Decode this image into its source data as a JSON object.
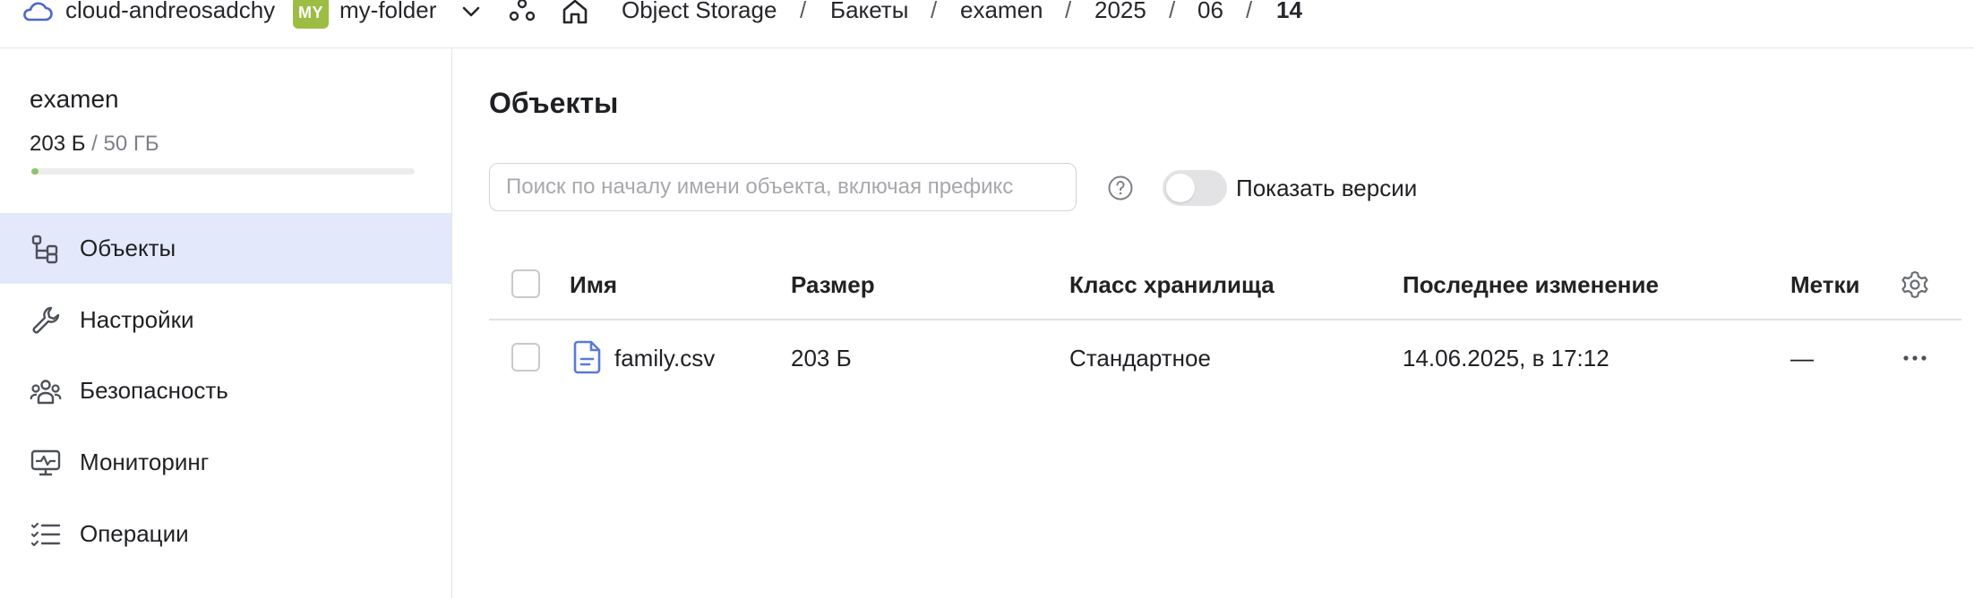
{
  "header": {
    "cloud_name": "cloud-andreosadchy",
    "folder_badge": "MY",
    "folder_name": "my-folder",
    "breadcrumbs": [
      "Object Storage",
      "Бакеты",
      "examen",
      "2025",
      "06",
      "14"
    ],
    "separator": "/"
  },
  "sidebar": {
    "bucket_name": "examen",
    "usage_used": "203 Б",
    "usage_total": " / 50 ГБ",
    "usage_fraction": 4e-06,
    "items": [
      {
        "label": "Объекты",
        "icon": "objects-icon",
        "active": true
      },
      {
        "label": "Настройки",
        "icon": "wrench-icon",
        "active": false
      },
      {
        "label": "Безопасность",
        "icon": "people-icon",
        "active": false
      },
      {
        "label": "Мониторинг",
        "icon": "monitor-icon",
        "active": false
      },
      {
        "label": "Операции",
        "icon": "list-icon",
        "active": false
      }
    ]
  },
  "main": {
    "title": "Объекты",
    "search_placeholder": "Поиск по началу имени объекта, включая префикс",
    "show_versions_label": "Показать версии",
    "show_versions_enabled": false,
    "table": {
      "columns": [
        "Имя",
        "Размер",
        "Класс хранилища",
        "Последнее изменение",
        "Метки"
      ],
      "rows": [
        {
          "name": "family.csv",
          "size": "203 Б",
          "storage_class": "Стандартное",
          "modified": "14.06.2025, в 17:12",
          "labels": "—"
        }
      ]
    }
  },
  "colors": {
    "accent": "#4c68c9",
    "active_nav": "#e3e9fb",
    "folder_badge": "#9bbd43",
    "usage_fill": "#8dc66a"
  }
}
